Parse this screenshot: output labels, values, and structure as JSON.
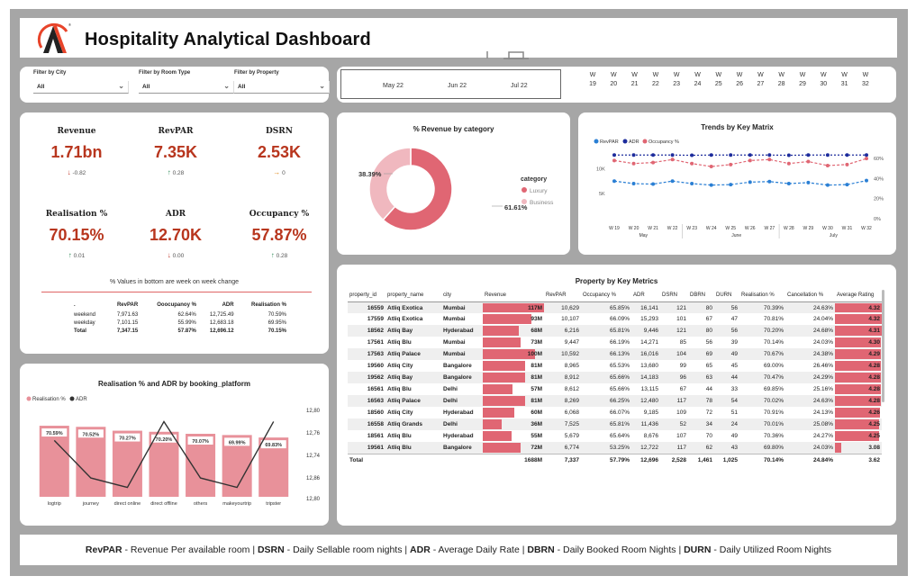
{
  "header": {
    "title": "Hospitality Analytical Dashboard",
    "colors": {
      "accent_red": "#e8442a",
      "brand_dark": "#222222"
    }
  },
  "filters": [
    {
      "label": "Filter by City",
      "value": "All"
    },
    {
      "label": "Filter by Room Type",
      "value": "All"
    },
    {
      "label": "Filter by Property",
      "value": "All"
    }
  ],
  "date_slicer": {
    "months": [
      "May 22",
      "Jun 22",
      "Jul 22"
    ],
    "weeks": [
      {
        "w": "W",
        "n": "19"
      },
      {
        "w": "W",
        "n": "20"
      },
      {
        "w": "W",
        "n": "21"
      },
      {
        "w": "W",
        "n": "22"
      },
      {
        "w": "W",
        "n": "23"
      },
      {
        "w": "W",
        "n": "24"
      },
      {
        "w": "W",
        "n": "25"
      },
      {
        "w": "W",
        "n": "26"
      },
      {
        "w": "W",
        "n": "27"
      },
      {
        "w": "W",
        "n": "28"
      },
      {
        "w": "W",
        "n": "29"
      },
      {
        "w": "W",
        "n": "30"
      },
      {
        "w": "W",
        "n": "31"
      },
      {
        "w": "W",
        "n": "32"
      }
    ]
  },
  "kpis": [
    {
      "label": "Revenue",
      "value": "1.71bn",
      "delta": "-0.82",
      "dir": "down"
    },
    {
      "label": "RevPAR",
      "value": "7.35K",
      "delta": "0.28",
      "dir": "up"
    },
    {
      "label": "DSRN",
      "value": "2.53K",
      "delta": "0",
      "dir": "right"
    },
    {
      "label": "Realisation %",
      "value": "70.15%",
      "delta": "0.01",
      "dir": "up"
    },
    {
      "label": "ADR",
      "value": "12.70K",
      "delta": "0.00",
      "dir": "down"
    },
    {
      "label": "Occupancy %",
      "value": "57.87%",
      "delta": "0.28",
      "dir": "up"
    }
  ],
  "wow": {
    "title": "% Values in bottom are week on week change",
    "headers": [
      ".",
      "RevPAR",
      "Ooocupanoy %",
      "ADR",
      "Realisation %"
    ],
    "rows": [
      [
        "weekend",
        "7,971.63",
        "62.64%",
        "12,725.49",
        "70.59%"
      ],
      [
        "weekday",
        "7,101.15",
        "55.99%",
        "12,683.18",
        "69.95%"
      ],
      [
        "Total",
        "7,347.15",
        "57.87%",
        "12,696.12",
        "70.15%"
      ]
    ]
  },
  "donut": {
    "title": "% Revenue by category",
    "legend_title": "category",
    "slices": [
      {
        "name": "Luxury",
        "value": 61.61,
        "label": "61.61%",
        "color": "#e06673"
      },
      {
        "name": "Business",
        "value": 38.39,
        "label": "38.39%",
        "color": "#f0b8bf"
      }
    ]
  },
  "trend": {
    "title": "Trends by Key Matrix",
    "legend": [
      {
        "name": "RevPAR",
        "color": "#2a7fd4"
      },
      {
        "name": "ADR",
        "color": "#1d2c9c"
      },
      {
        "name": "Occupancy %",
        "color": "#e06673"
      }
    ],
    "x_labels": [
      "W 19",
      "W 20",
      "W 21",
      "W 22",
      "W 23",
      "W 24",
      "W 25",
      "W 26",
      "W 27",
      "W 28",
      "W 29",
      "W 30",
      "W 31",
      "W 32"
    ],
    "months": [
      "May",
      "June",
      "July"
    ],
    "left_ticks": [
      "10K",
      "5K"
    ],
    "right_ticks": [
      "60%",
      "40%",
      "20%",
      "0%"
    ]
  },
  "realisation": {
    "title": "Realisation % and ADR by booking_platform",
    "legend": [
      {
        "name": "Realisation %",
        "color": "#e8919a"
      },
      {
        "name": "ADR",
        "color": "#333333"
      }
    ],
    "right_ticks": [
      "12,80",
      "12,76",
      "12,74",
      "12,86",
      "12,80"
    ]
  },
  "chart_data": [
    {
      "type": "pie",
      "title": "% Revenue by category",
      "categories": [
        "Luxury",
        "Business"
      ],
      "values": [
        61.61,
        38.39
      ]
    },
    {
      "type": "line",
      "title": "Trends by Key Matrix",
      "x": [
        "W 19",
        "W 20",
        "W 21",
        "W 22",
        "W 23",
        "W 24",
        "W 25",
        "W 26",
        "W 27",
        "W 28",
        "W 29",
        "W 30",
        "W 31",
        "W 32"
      ],
      "series": [
        {
          "name": "RevPAR",
          "values": [
            7500,
            7000,
            6900,
            7500,
            7000,
            6700,
            6800,
            7300,
            7400,
            7000,
            7200,
            6700,
            6800,
            7600
          ]
        },
        {
          "name": "ADR",
          "values": [
            12700,
            12700,
            12700,
            12700,
            12650,
            12700,
            12700,
            12700,
            12700,
            12650,
            12700,
            12700,
            12700,
            12700
          ]
        },
        {
          "name": "Occupancy %",
          "values": [
            58,
            55,
            56,
            59,
            55,
            52,
            54,
            58,
            59,
            55,
            57,
            53,
            54,
            60
          ]
        }
      ],
      "ylim": [
        0,
        14000
      ],
      "ylim_right": [
        0,
        70
      ]
    },
    {
      "type": "bar",
      "title": "Realisation % and ADR by booking_platform",
      "categories": [
        "logtrip",
        "journey",
        "direct online",
        "direct offline",
        "others",
        "makeyourtrip",
        "tripster"
      ],
      "series": [
        {
          "name": "Realisation %",
          "values": [
            70.59,
            70.52,
            70.27,
            70.2,
            70.07,
            69.99,
            69.83
          ],
          "labels": [
            "70.59%",
            "70.52%",
            "70.27%",
            "70.20%",
            "70.07%",
            "69.99%",
            "69.83%"
          ]
        },
        {
          "name": "ADR",
          "values": [
            12.78,
            12.74,
            12.73,
            12.8,
            12.74,
            12.73,
            12.8
          ]
        }
      ],
      "ylim": [
        12.72,
        12.81
      ]
    }
  ],
  "property_table": {
    "title": "Property by Key Metrics",
    "headers": [
      "property_id",
      "property_name",
      "city",
      "Revenue",
      "RevPAR",
      "Occupancy %",
      "ADR",
      "DSRN",
      "DBRN",
      "DURN",
      "Realisation %",
      "Cancellation %",
      "Average Rating"
    ],
    "rows": [
      [
        "16559",
        "Atliq Exotica",
        "Mumbai",
        "117M",
        "10,629",
        "65.85%",
        "16,141",
        "121",
        "80",
        "56",
        "70.39%",
        "24.63%",
        "4.32"
      ],
      [
        "17559",
        "Atliq Exotica",
        "Mumbai",
        "93M",
        "10,107",
        "66.09%",
        "15,293",
        "101",
        "67",
        "47",
        "70.81%",
        "24.04%",
        "4.32"
      ],
      [
        "18562",
        "Atliq Bay",
        "Hyderabad",
        "68M",
        "6,216",
        "65.81%",
        "9,446",
        "121",
        "80",
        "56",
        "70.20%",
        "24.68%",
        "4.31"
      ],
      [
        "17561",
        "Atliq Blu",
        "Mumbai",
        "73M",
        "9,447",
        "66.19%",
        "14,271",
        "85",
        "56",
        "39",
        "70.14%",
        "24.03%",
        "4.30"
      ],
      [
        "17563",
        "Atliq Palace",
        "Mumbai",
        "100M",
        "10,592",
        "66.13%",
        "16,016",
        "104",
        "69",
        "49",
        "70.67%",
        "24.38%",
        "4.29"
      ],
      [
        "19560",
        "Atliq City",
        "Bangalore",
        "81M",
        "8,965",
        "65.53%",
        "13,680",
        "99",
        "65",
        "45",
        "69.00%",
        "26.46%",
        "4.28"
      ],
      [
        "19562",
        "Atliq Bay",
        "Bangalore",
        "81M",
        "8,912",
        "65.66%",
        "14,183",
        "96",
        "63",
        "44",
        "70.47%",
        "24.29%",
        "4.28"
      ],
      [
        "16561",
        "Atliq Blu",
        "Delhi",
        "57M",
        "8,612",
        "65.66%",
        "13,115",
        "67",
        "44",
        "33",
        "69.85%",
        "25.16%",
        "4.28"
      ],
      [
        "16563",
        "Atliq Palace",
        "Delhi",
        "81M",
        "8,269",
        "66.25%",
        "12,480",
        "117",
        "78",
        "54",
        "70.02%",
        "24.63%",
        "4.28"
      ],
      [
        "18560",
        "Atliq City",
        "Hyderabad",
        "60M",
        "6,068",
        "66.07%",
        "9,185",
        "109",
        "72",
        "51",
        "70.91%",
        "24.13%",
        "4.26"
      ],
      [
        "16558",
        "Atliq Grands",
        "Delhi",
        "36M",
        "7,525",
        "65.81%",
        "11,436",
        "52",
        "34",
        "24",
        "70.01%",
        "25.08%",
        "4.25"
      ],
      [
        "18561",
        "Atliq Blu",
        "Hyderabad",
        "55M",
        "5,679",
        "65.64%",
        "8,676",
        "107",
        "70",
        "49",
        "70.36%",
        "24.27%",
        "4.25"
      ],
      [
        "19561",
        "Atliq Blu",
        "Bangalore",
        "72M",
        "6,774",
        "53.25%",
        "12,722",
        "117",
        "62",
        "43",
        "69.80%",
        "24.03%",
        "3.08"
      ]
    ],
    "revenue_values": [
      117,
      93,
      68,
      73,
      100,
      81,
      81,
      57,
      81,
      60,
      36,
      55,
      72
    ],
    "rating_values": [
      4.32,
      4.32,
      4.31,
      4.3,
      4.29,
      4.28,
      4.28,
      4.28,
      4.28,
      4.26,
      4.25,
      4.25,
      3.08
    ],
    "total": [
      "Total",
      "",
      "",
      "1688M",
      "7,337",
      "57.79%",
      "12,696",
      "2,528",
      "1,461",
      "1,025",
      "70.14%",
      "24.84%",
      "3.62"
    ]
  },
  "footer": [
    {
      "abbr": "RevPAR",
      "desc": " - Revenue Per available room | "
    },
    {
      "abbr": "DSRN",
      "desc": " - Daily Sellable room nights | "
    },
    {
      "abbr": "ADR",
      "desc": " - Average Daily Rate | "
    },
    {
      "abbr": "DBRN",
      "desc": " - Daily Booked Room Nights | "
    },
    {
      "abbr": "DURN",
      "desc": " - Daily Utilized Room Nights"
    }
  ]
}
